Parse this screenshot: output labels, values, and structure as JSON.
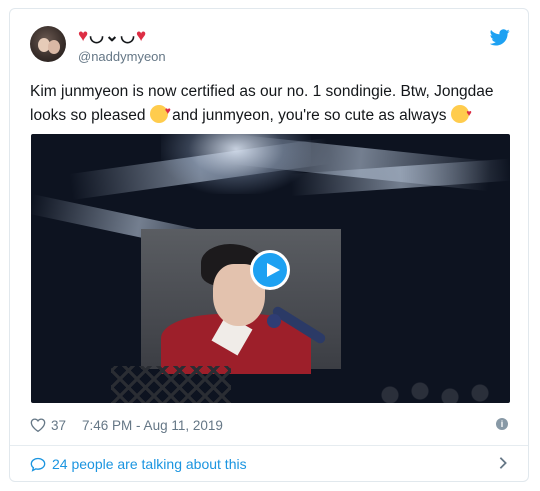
{
  "user": {
    "display_name_text": "◡⌄◡",
    "handle": "@naddymyeon"
  },
  "tweet": {
    "text_part1": "Kim junmyeon is now certified as our no. 1 sondingie. Btw, Jongdae looks so pleased ",
    "text_part2": " and junmyeon, you're so cute as always ",
    "emoji_1": "smiling-face-with-hearts",
    "emoji_2": "face-blowing-a-kiss"
  },
  "meta": {
    "likes": "37",
    "timestamp": "7:46 PM - Aug 11, 2019"
  },
  "conversation": {
    "label": "24 people are talking about this"
  },
  "colors": {
    "accent": "#1da1f2",
    "link": "#1b95e0",
    "heart": "#dd2e44",
    "muted": "#657786"
  },
  "icons": [
    "twitter-bird-icon",
    "heart-icon",
    "play-icon",
    "info-icon",
    "speech-bubble-icon",
    "chevron-right-icon"
  ]
}
